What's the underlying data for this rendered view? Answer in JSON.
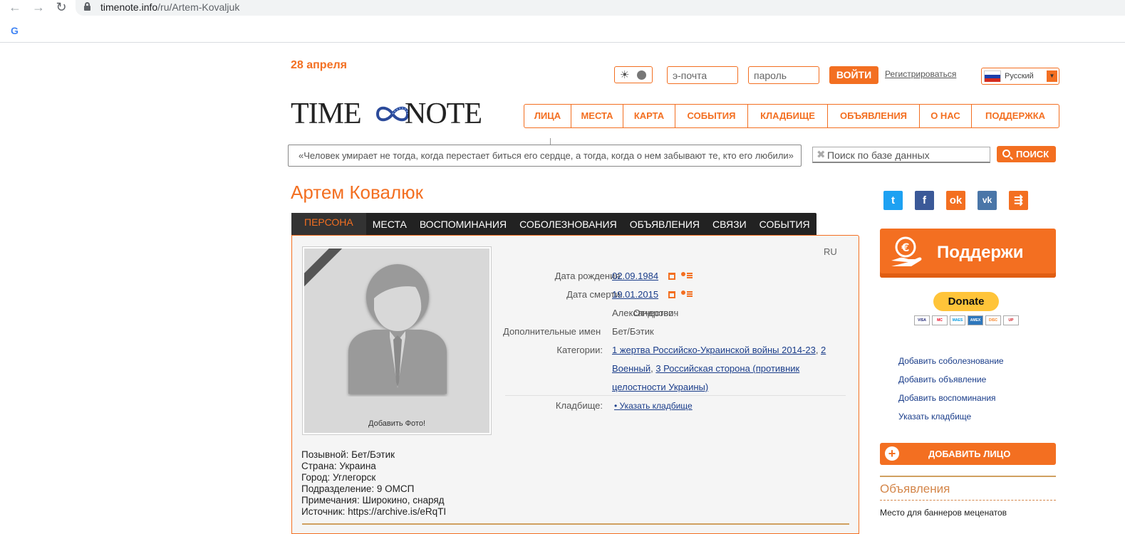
{
  "browser": {
    "url_host": "timenote.info",
    "url_path": "/ru/Artem-Kovaljuk"
  },
  "header": {
    "date": "28 апреля",
    "email_placeholder": "э-почта",
    "password_placeholder": "пароль",
    "login_label": "ВОЙТИ",
    "register_label": "Регистрироваться",
    "language": "Русский",
    "logo_left": "TIME",
    "logo_right": "NOTE"
  },
  "nav": {
    "items": [
      "ЛИЦА",
      "МЕСТА",
      "КАРТА",
      "СОБЫТИЯ",
      "КЛАДБИЩЕ",
      "ОБЪЯВЛЕНИЯ",
      "О НАС",
      "ПОДДЕРЖКА"
    ]
  },
  "quote": "«Человек умирает не тогда, когда перестает биться его сердце, а тогда, когда о нем забывают те, кто его любили»",
  "search": {
    "placeholder": "Поиск по базе данных",
    "button_label": "ПОИСК"
  },
  "person": {
    "name": "Артем Ковалюк",
    "lang_tag": "RU",
    "add_photo": "Добавить Фото!",
    "tabs": [
      "ПЕРСОНА",
      "МЕСТА",
      "ВОСПОМИНАНИЯ",
      "СОБОЛЕЗНОВАНИЯ",
      "ОБЪЯВЛЕНИЯ",
      "СВЯЗИ",
      "СОБЫТИЯ"
    ],
    "fields": {
      "birth_label": "Дата рождения:",
      "birth_value": "02.09.1984",
      "death_label": "Дата смерти:",
      "death_value": "19.01.2015",
      "patronymic_label": "Отчество:",
      "patronymic_value": "Александрович",
      "names_label": "Дополнительные имен",
      "names_value": "Бет/Бэтик",
      "categories_label": "Категории:",
      "category_1": "1 жертва Российско-Украинской войны 2014-23",
      "category_2a": "2",
      "category_2b": "Военный",
      "category_3a": "3 Российская сторона (противник",
      "category_3b": "целостности Украины)",
      "cemetery_label": "Кладбище:",
      "cemetery_value": "• Указать кладбище"
    },
    "details": [
      "Позывной: Бет/Бэтик",
      "Страна: Украина",
      "Город: Углегорск",
      "Подразделение: 9 ОМСП",
      "Примечания: Широкино, снаряд",
      "Источник: https://archive.is/eRqTI"
    ]
  },
  "sidebar": {
    "support_label": "Поддержи",
    "donate_label": "Donate",
    "cards": [
      "VISA",
      "MC",
      "MAES",
      "AMEX",
      "DISC",
      "UP"
    ],
    "links": [
      "Добавить соболезнование",
      "Добавить объявление",
      "Добавить воспоминания",
      "Указать кладбище"
    ],
    "add_person_label": "ДОБАВИТЬ ЛИЦО",
    "ads_title": "Объявления",
    "ads_text": "Место для баннеров меценатов"
  },
  "colors": {
    "accent": "#f36f21",
    "link": "#1a3d8a"
  }
}
